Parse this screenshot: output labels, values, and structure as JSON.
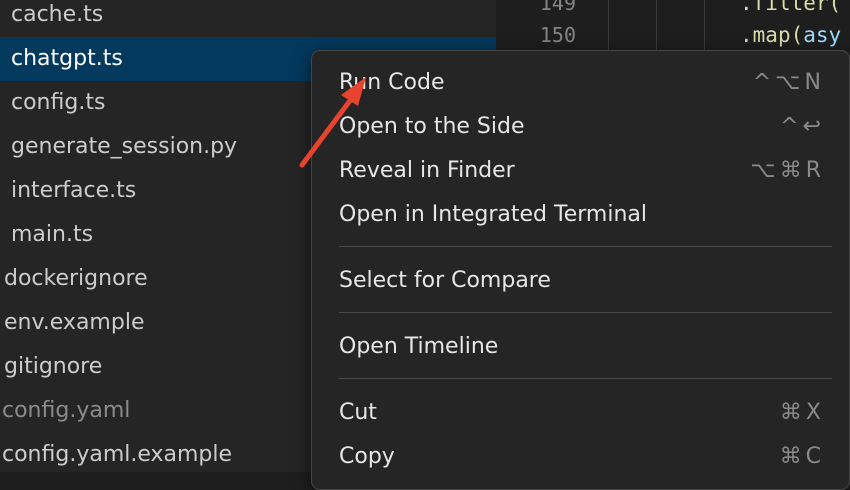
{
  "explorer": {
    "files": [
      {
        "label": "cache.ts"
      },
      {
        "label": "chatgpt.ts"
      },
      {
        "label": "config.ts"
      },
      {
        "label": "generate_session.py"
      },
      {
        "label": "interface.ts"
      },
      {
        "label": "main.ts"
      },
      {
        "label": "dockerignore"
      },
      {
        "label": "env.example"
      },
      {
        "label": "gitignore"
      },
      {
        "label": "config.yaml"
      },
      {
        "label": "config.yaml.example"
      }
    ],
    "selected_file": "chatgpt.ts"
  },
  "editor": {
    "line_numbers": [
      "149",
      "150"
    ],
    "code": {
      "line1_prefix": ".",
      "line1_fn": "filter(",
      "line2_prefix": ".",
      "line2_fn": "map(",
      "line2_rest": "asy"
    }
  },
  "context_menu": {
    "run_code": {
      "label": "Run Code",
      "shortcut": "^⌥N"
    },
    "open_to_side": {
      "label": "Open to the Side",
      "shortcut": "^↩"
    },
    "reveal_in_finder": {
      "label": "Reveal in Finder",
      "shortcut": "⌥⌘R"
    },
    "open_in_terminal": {
      "label": "Open in Integrated Terminal"
    },
    "select_for_compare": {
      "label": "Select for Compare"
    },
    "open_timeline": {
      "label": "Open Timeline"
    },
    "cut": {
      "label": "Cut",
      "shortcut": "⌘X"
    },
    "copy": {
      "label": "Copy",
      "shortcut": "⌘C"
    }
  },
  "annotation": {
    "color": "#e8432e"
  }
}
